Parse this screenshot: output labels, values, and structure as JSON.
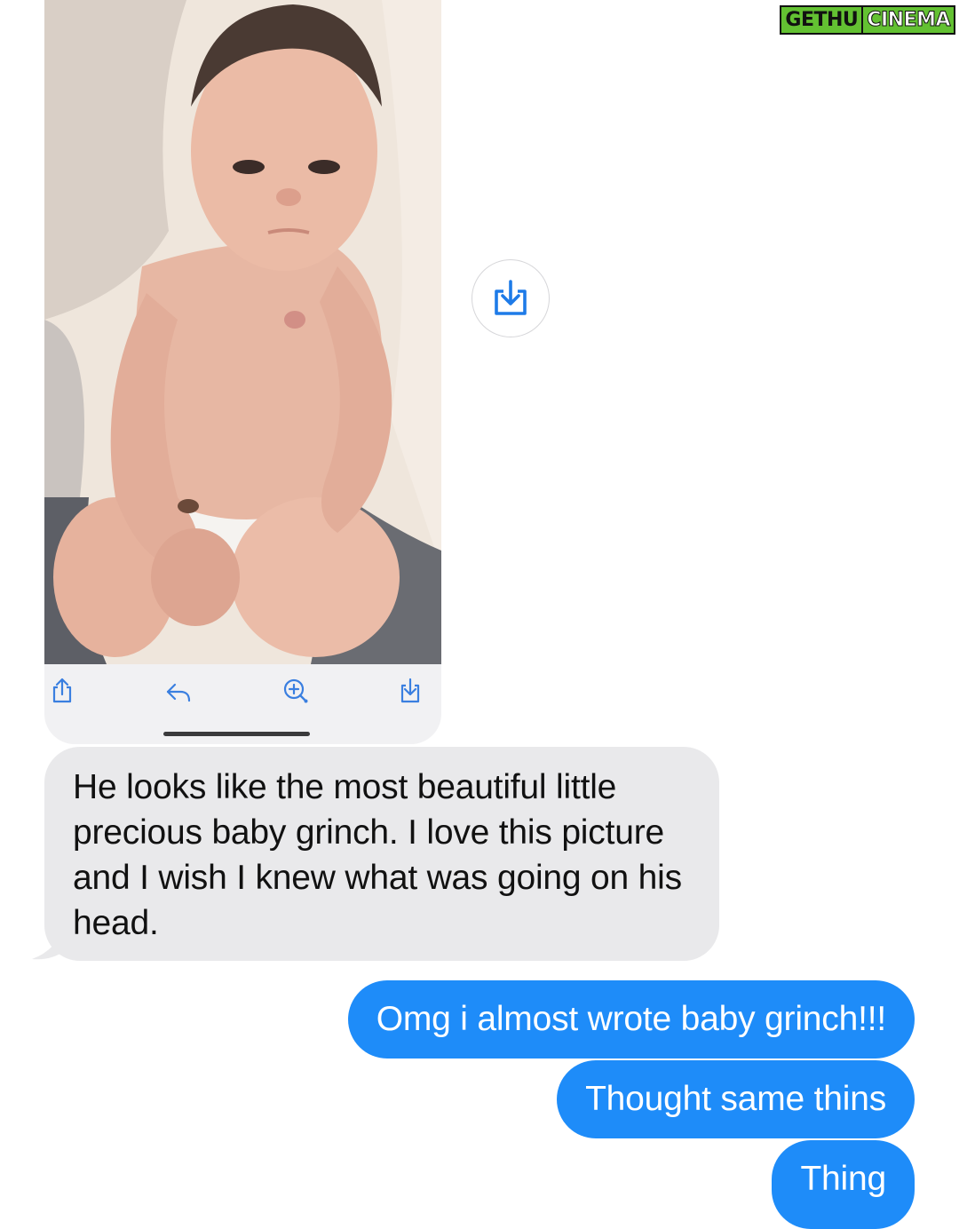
{
  "watermark": {
    "part1": "GETHU",
    "part2": "CINEMA"
  },
  "attachment": {
    "photo_subject": "newborn-baby-photo",
    "toolbar_icons": [
      "share-icon",
      "reply-icon",
      "zoom-icon",
      "save-icon"
    ],
    "accent_color": "#3a7fe0"
  },
  "side_action": {
    "icon": "save-download-icon"
  },
  "messages": {
    "received": [
      {
        "text": "He looks like the most beautiful little precious baby grinch. I love this picture and I wish I knew what was going on his head."
      }
    ],
    "sent": [
      {
        "text": "Omg i almost wrote baby grinch!!!"
      },
      {
        "text": "Thought same thins"
      },
      {
        "text": "Thing"
      }
    ]
  },
  "colors": {
    "sent_bubble": "#1e8cf9",
    "received_bubble": "#e9e9eb",
    "watermark_green": "#63c132"
  }
}
